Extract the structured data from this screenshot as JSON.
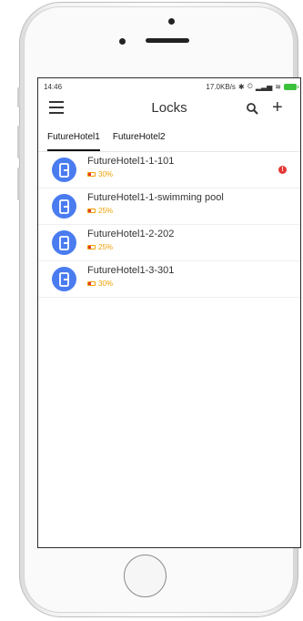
{
  "status_bar": {
    "time": "14:46",
    "network_speed": "17.0KB/s"
  },
  "app_bar": {
    "title": "Locks"
  },
  "tabs": [
    {
      "label": "FutureHotel1",
      "active": true
    },
    {
      "label": "FutureHotel2",
      "active": false
    }
  ],
  "locks": [
    {
      "name": "FutureHotel1-1-101",
      "battery": "30%",
      "alert": true
    },
    {
      "name": "FutureHotel1-1-swimming pool",
      "battery": "25%",
      "alert": false
    },
    {
      "name": "FutureHotel1-2-202",
      "battery": "25%",
      "alert": false
    },
    {
      "name": "FutureHotel1-3-301",
      "battery": "30%",
      "alert": false
    }
  ],
  "colors": {
    "lock_icon_bg": "#4a7cf0",
    "battery_text": "#f0a000",
    "alert": "#e53935"
  },
  "icons": [
    "menu-icon",
    "search-icon",
    "add-icon",
    "lock-icon",
    "battery-icon",
    "alert-icon"
  ]
}
